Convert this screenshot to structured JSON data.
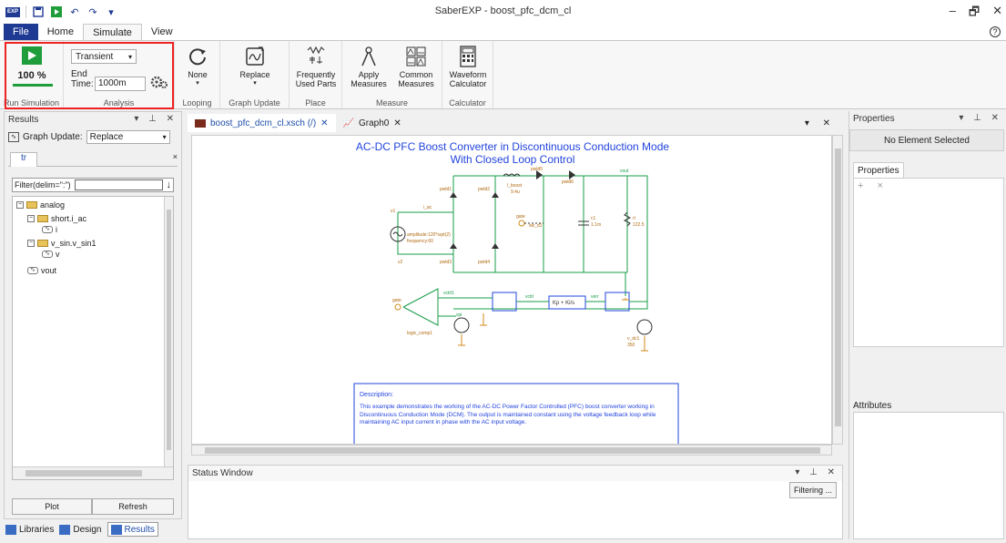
{
  "window": {
    "title": "SaberEXP - boost_pfc_dcm_cl",
    "app_logo": "EXP",
    "controls": [
      "–",
      "🗗",
      "✕"
    ]
  },
  "menu": {
    "tabs": [
      "File",
      "Home",
      "Simulate",
      "View"
    ],
    "active": "Simulate",
    "help": "?"
  },
  "ribbon": {
    "run": {
      "percent": "100 %",
      "group": "Run Simulation",
      "progress": 1.0
    },
    "analysis": {
      "mode": "Transient",
      "end_label": "End",
      "time_label": "Time:",
      "end_time": "1000m",
      "group": "Analysis"
    },
    "looping": {
      "label": "None",
      "group": "Looping"
    },
    "graph_update": {
      "label": "Replace",
      "group": "Graph Update"
    },
    "place": {
      "label1": "Frequently",
      "label2": "Used Parts",
      "group": "Place"
    },
    "measure": {
      "apply1": "Apply",
      "apply2": "Measures",
      "common1": "Common",
      "common2": "Measures",
      "group": "Measure"
    },
    "calculator": {
      "label1": "Waveform",
      "label2": "Calculator",
      "group": "Calculator"
    }
  },
  "results": {
    "title": "Results",
    "graph_update_label": "Graph Update:",
    "graph_update_value": "Replace",
    "tab": "tr",
    "filter_label": "Filter(delim=\":\")",
    "tree": [
      {
        "label": "analog"
      },
      {
        "label": "short.i_ac"
      },
      {
        "label": "i"
      },
      {
        "label": "v_sin.v_sin1"
      },
      {
        "label": "v"
      },
      {
        "label": "vout"
      }
    ],
    "plot_btn": "Plot",
    "refresh_btn": "Refresh"
  },
  "bottom_tabs": [
    "Libraries",
    "Design",
    "Results"
  ],
  "doc": {
    "tabs": [
      "boost_pfc_dcm_cl.xsch (/)",
      "Graph0"
    ],
    "schematic": {
      "title1": "AC-DC PFC Boost  Converter in Discontinuous Conduction Mode",
      "title2": "With Closed Loop Control",
      "labels": {
        "pwld1": "pwld1",
        "pwld2": "pwld2",
        "pwld3": "pwld3",
        "pwld4": "pwld4",
        "pwld5": "pwld5",
        "pwld6": "pwld6",
        "iac": "i_ac",
        "v1": "v1",
        "v2": "v2",
        "amp": "amplitude:120*sqrt(2)",
        "freq": "frequency:60",
        "lboost": "l_boost",
        "lval": "9.4u",
        "gate": "gate",
        "swd1": "sw_d1",
        "c1": "c1",
        "cval": "1.1m",
        "rl": "rl",
        "rval": "122.5",
        "vout": "vout",
        "vctrl1": "vctrl1",
        "vctrl": "vctrl",
        "verr": "verr",
        "logic": "logic_comp1",
        "kp": "Kp + Ki/s",
        "vdc": "v_dc1",
        "vdcval": "350",
        "vpi": "vpi"
      },
      "description_title": "Description:",
      "description": "This example demonstrates the working of the AC-DC Power Factor Controlled (PFC) boost converter working in Discontinuous Conduction Mode (DCM). The output is maintained constant using the voltage feedback loop while maintaining AC input current in phase with the AC input voltage."
    }
  },
  "status": {
    "title": "Status Window",
    "filter_btn": "Filtering ..."
  },
  "properties": {
    "title": "Properties",
    "no_element": "No Element Selected",
    "tab": "Properties",
    "attributes": "Attributes"
  }
}
